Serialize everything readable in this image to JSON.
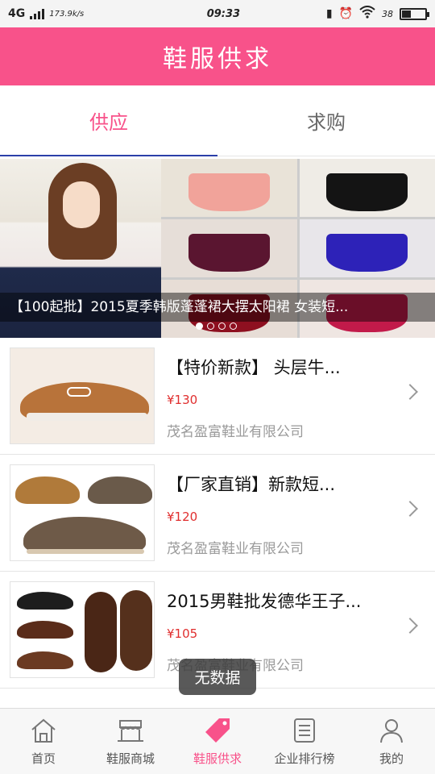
{
  "status_bar": {
    "network": "4G",
    "speed": "173.9k/s",
    "time": "09:33",
    "battery": "38",
    "battery_level": 0.38
  },
  "header": {
    "title": "鞋服供求"
  },
  "tabs": [
    {
      "label": "供应",
      "active": true
    },
    {
      "label": "求购",
      "active": false
    }
  ],
  "banner": {
    "caption": "【100起批】2015夏季韩版蓬蓬裙大摆太阳裙 女装短...",
    "dot_count": 4,
    "active_dot": 0
  },
  "products": [
    {
      "name": "【特价新款】 头层牛...",
      "price": "¥130",
      "company": "茂名盈富鞋业有限公司"
    },
    {
      "name": "【厂家直销】新款短...",
      "price": "¥120",
      "company": "茂名盈富鞋业有限公司"
    },
    {
      "name": "2015男鞋批发德华王子...",
      "price": "¥105",
      "company": "茂名盈富鞋业有限公司"
    }
  ],
  "toast": "无数据",
  "bottom_nav": [
    {
      "label": "首页",
      "icon": "home-icon",
      "active": false
    },
    {
      "label": "鞋服商城",
      "icon": "store-icon",
      "active": false
    },
    {
      "label": "鞋服供求",
      "icon": "tag-icon",
      "active": true
    },
    {
      "label": "企业排行榜",
      "icon": "list-icon",
      "active": false
    },
    {
      "label": "我的",
      "icon": "user-icon",
      "active": false
    }
  ],
  "colors": {
    "brand": "#f8528a",
    "price": "#e02e2e",
    "tab_indicator": "#2b3fa8"
  }
}
